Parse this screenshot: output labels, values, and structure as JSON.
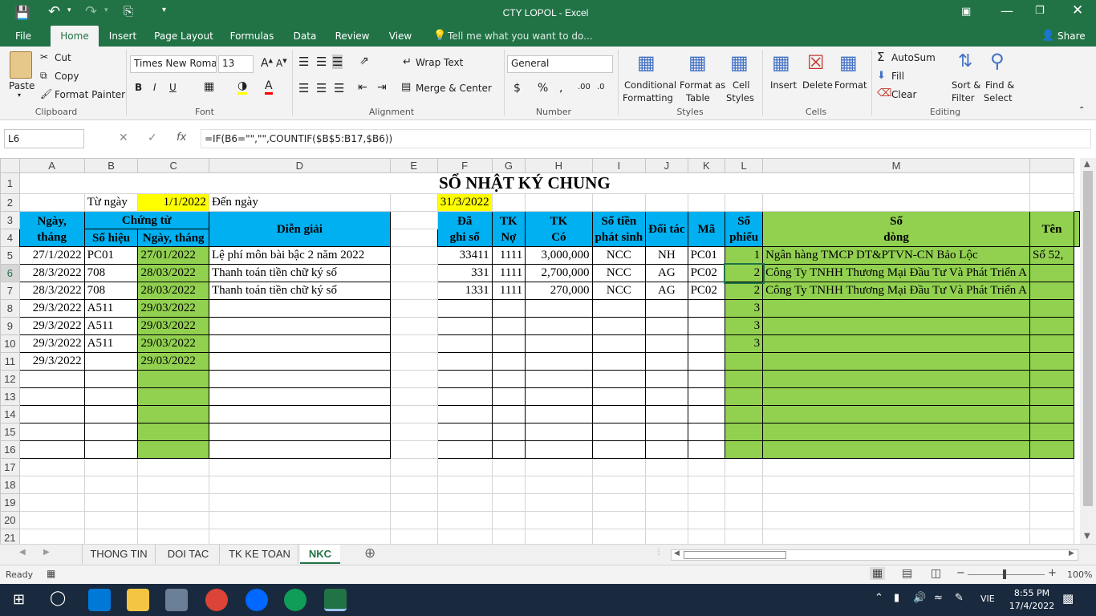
{
  "window": {
    "title": "CTY LOPOL - Excel",
    "share_label": "Share"
  },
  "ribbon_tabs": [
    "File",
    "Home",
    "Insert",
    "Page Layout",
    "Formulas",
    "Data",
    "Review",
    "View"
  ],
  "tell_me": "Tell me what you want to do...",
  "clipboard": {
    "paste": "Paste",
    "cut": "Cut",
    "copy": "Copy",
    "format_painter": "Format Painter",
    "label": "Clipboard"
  },
  "font": {
    "name": "Times New Roma",
    "size": "13",
    "label": "Font"
  },
  "alignment": {
    "wrap_text": "Wrap Text",
    "merge_center": "Merge & Center",
    "label": "Alignment"
  },
  "number": {
    "format": "General",
    "label": "Number"
  },
  "styles": {
    "conditional_1": "Conditional",
    "conditional_2": "Formatting",
    "format_as_1": "Format as",
    "format_as_2": "Table",
    "cell_1": "Cell",
    "cell_2": "Styles",
    "label": "Styles"
  },
  "cells": {
    "insert": "Insert",
    "delete": "Delete",
    "format": "Format",
    "label": "Cells"
  },
  "editing": {
    "autosum": "AutoSum",
    "fill": "Fill",
    "clear": "Clear",
    "sort_1": "Sort &",
    "sort_2": "Filter",
    "find_1": "Find &",
    "find_2": "Select",
    "label": "Editing"
  },
  "formula_bar": {
    "name_box": "L6",
    "formula": "=IF(B6=\"\",\"\",COUNTIF($B$5:B17,$B6))"
  },
  "columns": [
    "A",
    "B",
    "C",
    "D",
    "E",
    "F",
    "G",
    "H",
    "I",
    "J",
    "K",
    "L",
    "M"
  ],
  "sheet": {
    "title": "SỔ NHẬT KÝ CHUNG",
    "from_label": "Từ ngày",
    "from_date": "1/1/2022",
    "to_label": "Đến ngày",
    "to_date": "31/3/2022",
    "headers": {
      "ngay_thang_1": "Ngày,",
      "ngay_thang_2": "tháng",
      "chung_tu": "Chứng từ",
      "so_hieu": "Số hiệu",
      "ngay_thang_ct": "Ngày, tháng",
      "dien_giai": "Diễn giải",
      "da_ghi_so_1": "Đã",
      "da_ghi_so_2": "ghi sổ",
      "tk_no_1": "TK",
      "tk_no_2": "Nợ",
      "tk_co_1": "TK",
      "tk_co_2": "Có",
      "so_tien_1": "Số tiền",
      "so_tien_2": "phát sinh",
      "doi_tac": "Đối tác",
      "ma": "Mã",
      "so_phieu_1": "Số",
      "so_phieu_2": "phiếu",
      "so_dong_1": "Số",
      "so_dong_2": "dòng",
      "ten": "Tên"
    },
    "rows": [
      {
        "a": "27/1/2022",
        "b": "PC01",
        "c": "27/01/2022",
        "d": "Lệ phí môn bài bậc 2 năm 2022",
        "f": "33411",
        "g": "1111",
        "h": "3,000,000",
        "i": "NCC",
        "j": "NH",
        "k": "PC01",
        "l": "1",
        "m": "Ngân hàng TMCP DT&PTVN-CN Bảo Lộc",
        "n": "Số 52,"
      },
      {
        "a": "28/3/2022",
        "b": "708",
        "c": "28/03/2022",
        "d": "Thanh toán tiền chữ ký số",
        "f": "331",
        "g": "1111",
        "h": "2,700,000",
        "i": "NCC",
        "j": "AG",
        "k": "PC02",
        "l": "2",
        "m": "Công Ty TNHH Thương Mại Đầu Tư Và Phát Triển A",
        "n": ""
      },
      {
        "a": "28/3/2022",
        "b": "708",
        "c": "28/03/2022",
        "d": "Thanh toán tiền chữ ký số",
        "f": "1331",
        "g": "1111",
        "h": "270,000",
        "i": "NCC",
        "j": "AG",
        "k": "PC02",
        "l": "2",
        "m": "Công Ty TNHH Thương Mại Đầu Tư Và Phát Triển A",
        "n": ""
      },
      {
        "a": "29/3/2022",
        "b": "A511",
        "c": "29/03/2022",
        "d": "",
        "f": "",
        "g": "",
        "h": "",
        "i": "",
        "j": "",
        "k": "",
        "l": "3",
        "m": "",
        "n": ""
      },
      {
        "a": "29/3/2022",
        "b": "A511",
        "c": "29/03/2022",
        "d": "",
        "f": "",
        "g": "",
        "h": "",
        "i": "",
        "j": "",
        "k": "",
        "l": "3",
        "m": "",
        "n": ""
      },
      {
        "a": "29/3/2022",
        "b": "A511",
        "c": "29/03/2022",
        "d": "",
        "f": "",
        "g": "",
        "h": "",
        "i": "",
        "j": "",
        "k": "",
        "l": "3",
        "m": "",
        "n": ""
      },
      {
        "a": "29/3/2022",
        "b": "",
        "c": "29/03/2022",
        "d": "",
        "f": "",
        "g": "",
        "h": "",
        "i": "",
        "j": "",
        "k": "",
        "l": "",
        "m": "",
        "n": ""
      }
    ]
  },
  "sheet_tabs": [
    "THONG TIN",
    "DOI TAC",
    "TK KE TOAN",
    "NKC"
  ],
  "status": {
    "ready": "Ready",
    "zoom": "100%"
  },
  "taskbar": {
    "language": "VIE",
    "time": "8:55 PM",
    "date": "17/4/2022"
  },
  "colors": {
    "excel_green": "#217346",
    "header_blue": "#00b0f0",
    "highlight_yellow": "#ffff00",
    "fill_green": "#92d050"
  }
}
